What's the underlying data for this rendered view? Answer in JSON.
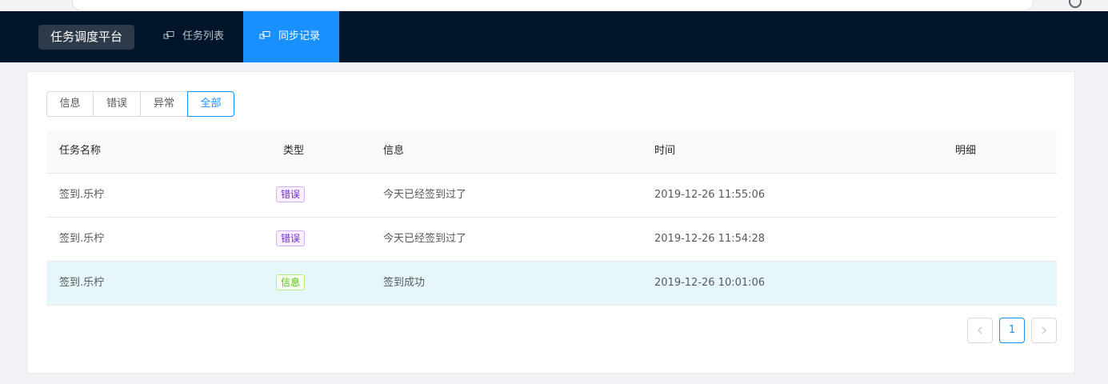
{
  "app": {
    "logo_text": "任务调度平台"
  },
  "nav": {
    "items": [
      {
        "label": "任务列表",
        "icon": "desktop-icon",
        "active": false
      },
      {
        "label": "同步记录",
        "icon": "desktop-icon",
        "active": true
      }
    ]
  },
  "filter": {
    "options": [
      "信息",
      "错误",
      "异常",
      "全部"
    ],
    "selected": "全部"
  },
  "table": {
    "columns": [
      "任务名称",
      "类型",
      "信息",
      "时间",
      "明细"
    ],
    "rows": [
      {
        "name": "签到.乐柠",
        "type": "错误",
        "type_kind": "error",
        "message": "今天已经签到过了",
        "time": "2019-12-26 11:55:06",
        "detail": "",
        "highlight": false
      },
      {
        "name": "签到.乐柠",
        "type": "错误",
        "type_kind": "error",
        "message": "今天已经签到过了",
        "time": "2019-12-26 11:54:28",
        "detail": "",
        "highlight": false
      },
      {
        "name": "签到.乐柠",
        "type": "信息",
        "type_kind": "info",
        "message": "签到成功",
        "time": "2019-12-26 10:01:06",
        "detail": "",
        "highlight": true
      }
    ]
  },
  "pagination": {
    "current_page": "1",
    "prev_icon": "chevron-left-icon",
    "next_icon": "chevron-right-icon"
  },
  "colors": {
    "header_bg": "#001529",
    "primary": "#1890ff",
    "tag_error_text": "#722ed1",
    "tag_error_border": "#d3adf7",
    "tag_error_bg": "#f9f0ff",
    "tag_info_text": "#52c41a",
    "tag_info_border": "#b7eb8f",
    "tag_info_bg": "#f6ffed",
    "row_highlight": "#e6f7fc"
  }
}
